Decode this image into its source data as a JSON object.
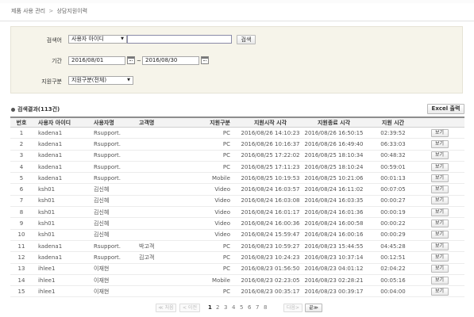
{
  "breadcrumb": {
    "section": "제품 사용 관리",
    "separator": ">",
    "page": "상담지원이력"
  },
  "search": {
    "keyword_label": "검색어",
    "keyword_type": "사용자 아이디",
    "keyword_value": "",
    "search_button": "검색",
    "period_label": "기간",
    "date_from": "2016/08/01",
    "date_sep": "~",
    "date_to": "2016/08/30",
    "support_type_label": "지원구분",
    "support_type": "지원구분(전체)"
  },
  "results": {
    "title": "검색결과(113건)",
    "excel_button": "Excel 출력",
    "columns": [
      "번호",
      "사용자 아이디",
      "사용자명",
      "고객명",
      "지원구분",
      "지원시작 시각",
      "지원종료 시각",
      "지원 시간",
      ""
    ],
    "view_label": "보기",
    "rows": [
      {
        "no": "1",
        "id": "kadena1",
        "user": "Rsupport.",
        "customer": "",
        "type": "PC",
        "start": "2016/08/26 14:10:23",
        "end": "2016/08/26 16:50:15",
        "duration": "02:39:52"
      },
      {
        "no": "2",
        "id": "kadena1",
        "user": "Rsupport.",
        "customer": "",
        "type": "PC",
        "start": "2016/08/26 10:16:37",
        "end": "2016/08/26 16:49:40",
        "duration": "06:33:03"
      },
      {
        "no": "3",
        "id": "kadena1",
        "user": "Rsupport.",
        "customer": "",
        "type": "PC",
        "start": "2016/08/25 17:22:02",
        "end": "2016/08/25 18:10:34",
        "duration": "00:48:32"
      },
      {
        "no": "4",
        "id": "kadena1",
        "user": "Rsupport.",
        "customer": "",
        "type": "PC",
        "start": "2016/08/25 17:11:23",
        "end": "2016/08/25 18:10:24",
        "duration": "00:59:01"
      },
      {
        "no": "5",
        "id": "kadena1",
        "user": "Rsupport.",
        "customer": "",
        "type": "Mobile",
        "start": "2016/08/25 10:19:53",
        "end": "2016/08/25 10:21:06",
        "duration": "00:01:13"
      },
      {
        "no": "6",
        "id": "ksh01",
        "user": "김신혜",
        "customer": "",
        "type": "Video",
        "start": "2016/08/24 16:03:57",
        "end": "2016/08/24 16:11:02",
        "duration": "00:07:05"
      },
      {
        "no": "7",
        "id": "ksh01",
        "user": "김신혜",
        "customer": "",
        "type": "Video",
        "start": "2016/08/24 16:03:08",
        "end": "2016/08/24 16:03:35",
        "duration": "00:00:27"
      },
      {
        "no": "8",
        "id": "ksh01",
        "user": "김신혜",
        "customer": "",
        "type": "Video",
        "start": "2016/08/24 16:01:17",
        "end": "2016/08/24 16:01:36",
        "duration": "00:00:19"
      },
      {
        "no": "9",
        "id": "ksh01",
        "user": "김신혜",
        "customer": "",
        "type": "Video",
        "start": "2016/08/24 16:00:36",
        "end": "2016/08/24 16:00:58",
        "duration": "00:00:22"
      },
      {
        "no": "10",
        "id": "ksh01",
        "user": "김신혜",
        "customer": "",
        "type": "Video",
        "start": "2016/08/24 15:59:47",
        "end": "2016/08/24 16:00:16",
        "duration": "00:00:29"
      },
      {
        "no": "11",
        "id": "kadena1",
        "user": "Rsupport.",
        "customer": "박고객",
        "type": "PC",
        "start": "2016/08/23 10:59:27",
        "end": "2016/08/23 15:44:55",
        "duration": "04:45:28"
      },
      {
        "no": "12",
        "id": "kadena1",
        "user": "Rsupport.",
        "customer": "김고객",
        "type": "PC",
        "start": "2016/08/23 10:24:23",
        "end": "2016/08/23 10:37:14",
        "duration": "00:12:51"
      },
      {
        "no": "13",
        "id": "ihlee1",
        "user": "이재현",
        "customer": "",
        "type": "PC",
        "start": "2016/08/23 01:56:50",
        "end": "2016/08/23 04:01:12",
        "duration": "02:04:22"
      },
      {
        "no": "14",
        "id": "ihlee1",
        "user": "이재현",
        "customer": "",
        "type": "Mobile",
        "start": "2016/08/23 02:23:05",
        "end": "2016/08/23 02:28:21",
        "duration": "00:05:16"
      },
      {
        "no": "15",
        "id": "ihlee1",
        "user": "이재현",
        "customer": "",
        "type": "PC",
        "start": "2016/08/23 00:35:17",
        "end": "2016/08/23 00:39:17",
        "duration": "00:04:00"
      }
    ]
  },
  "pagination": {
    "first": "≪ 처음",
    "prev": "< 이전",
    "pages": [
      "1",
      "2",
      "3",
      "4",
      "5",
      "6",
      "7",
      "8"
    ],
    "current": "1",
    "next": "다음>",
    "last": "끝≫"
  },
  "colors": {
    "panel_bg": "#f6f4ea",
    "header_rule": "#8d8d8d"
  }
}
